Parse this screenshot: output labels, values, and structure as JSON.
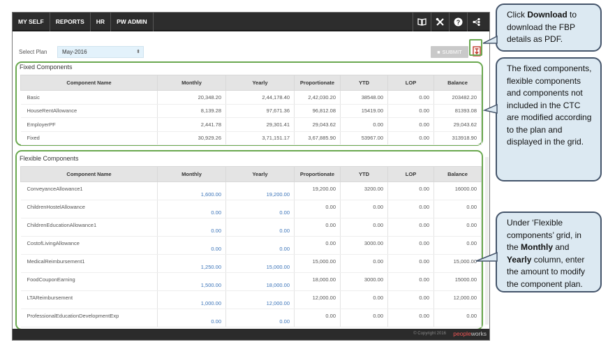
{
  "nav": [
    "MY SELF",
    "REPORTS",
    "HR",
    "PW ADMIN"
  ],
  "icons": [
    "book-icon",
    "tools-icon",
    "help-icon",
    "share-icon"
  ],
  "plan": {
    "label": "Select Plan",
    "value": "May-2016"
  },
  "submit_label": "SUBMIT",
  "columns": [
    "Component Name",
    "Monthly",
    "Yearly",
    "Proportionate",
    "YTD",
    "LOP",
    "Balance"
  ],
  "fixed": {
    "title": "Fixed Components",
    "rows": [
      [
        "Basic",
        "20,348.20",
        "2,44,178.40",
        "2,42,030.20",
        "38548.00",
        "0.00",
        "203482.20"
      ],
      [
        "HouseRentAllowance",
        "8,139.28",
        "97,671.36",
        "96,812.08",
        "15419.00",
        "0.00",
        "81393.08"
      ],
      [
        "EmployerPF",
        "2,441.78",
        "29,301.41",
        "29,043.62",
        "0.00",
        "0.00",
        "29,043.62"
      ],
      [
        "Fixed",
        "30,929.26",
        "3,71,151.17",
        "3,67,885.90",
        "53967.00",
        "0.00",
        "313918.90"
      ]
    ]
  },
  "flexible": {
    "title": "Flexible Components",
    "rows": [
      [
        "ConveyanceAllowance1",
        "1,600.00",
        "19,200.00",
        "19,200.00",
        "3200.00",
        "0.00",
        "16000.00"
      ],
      [
        "ChildrenHostelAllowance",
        "0.00",
        "0.00",
        "0.00",
        "0.00",
        "0.00",
        "0.00"
      ],
      [
        "ChildrenEducationAllowance1",
        "0.00",
        "0.00",
        "0.00",
        "0.00",
        "0.00",
        "0.00"
      ],
      [
        "CostofLivingAllowance",
        "0.00",
        "0.00",
        "0.00",
        "3000.00",
        "0.00",
        "0.00"
      ],
      [
        "MedicalReimbursement1",
        "1,250.00",
        "15,000.00",
        "15,000.00",
        "0.00",
        "0.00",
        "15,000.00"
      ],
      [
        "FoodCouponEarning",
        "1,500.00",
        "18,000.00",
        "18,000.00",
        "3000.00",
        "0.00",
        "15000.00"
      ],
      [
        "LTAReimbursement",
        "1,000.00",
        "12,000.00",
        "12,000.00",
        "0.00",
        "0.00",
        "12,000.00"
      ],
      [
        "ProfessionalEducationDevelopmentExp",
        "0.00",
        "0.00",
        "0.00",
        "0.00",
        "0.00",
        "0.00"
      ]
    ]
  },
  "footer": {
    "copyright": "© Copyright 2016",
    "brand_a": "people",
    "brand_b": "works"
  },
  "callouts": {
    "c1": {
      "pre": "Click ",
      "bold": "Download",
      "post": " to download the FBP details as PDF."
    },
    "c2": {
      "text": "The fixed components, flexible components and components not included in the CTC are modified according to the plan and displayed in the grid."
    },
    "c3": {
      "pre": "Under ‘Flexible components’ grid, in the ",
      "b1": "Monthly",
      "mid": " and ",
      "b2": "Yearly",
      "post": " column, enter the amount to modify the component plan."
    }
  },
  "colors": {
    "accent_green": "#6aa84f",
    "link_blue": "#3a73b8",
    "callout_bg": "#dce9f2",
    "topbar": "#2d2d2d"
  }
}
